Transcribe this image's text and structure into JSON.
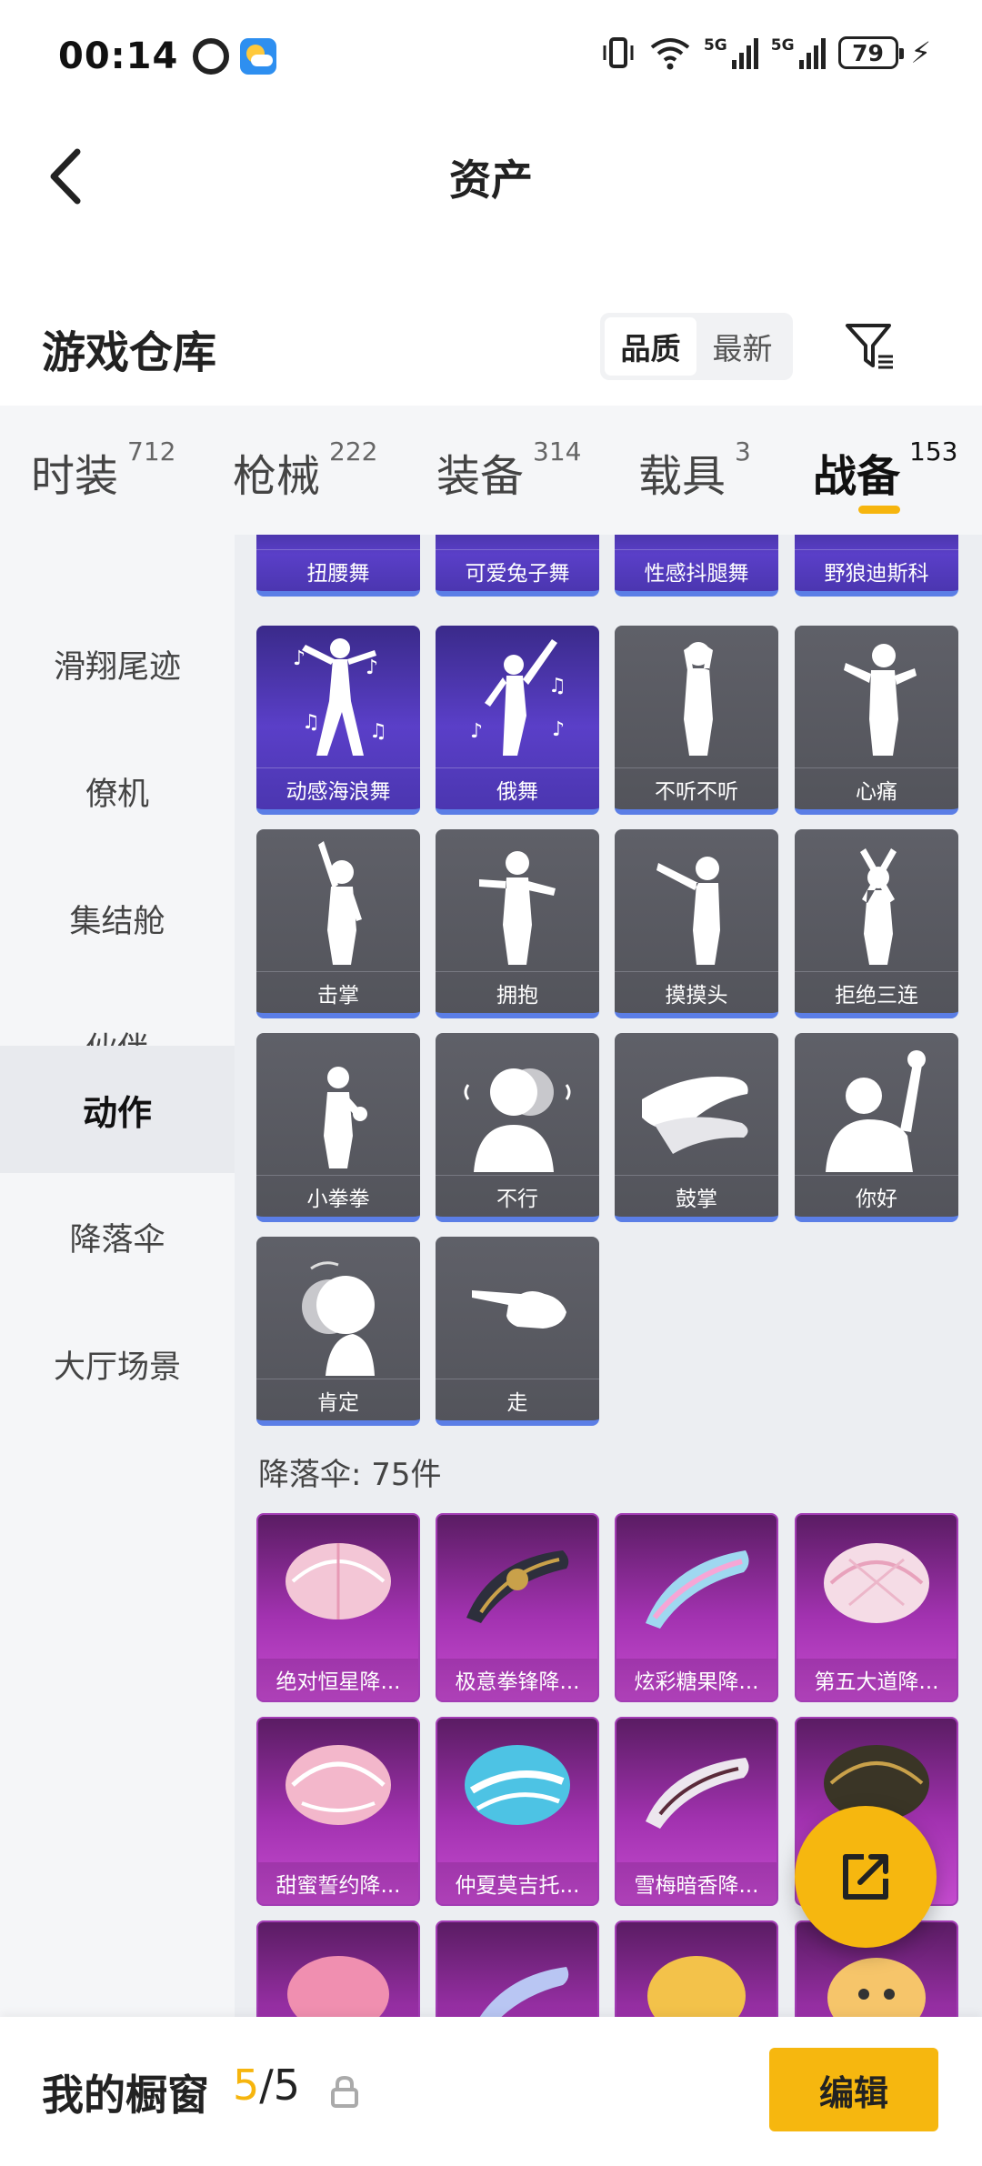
{
  "status_bar": {
    "time": "00:14",
    "battery": "79",
    "network_1": "5G",
    "network_2": "5G",
    "icons": [
      "alarm-icon",
      "weather-icon",
      "vibrate-icon",
      "wifi-icon",
      "signal-icon",
      "battery-icon",
      "charging-icon"
    ]
  },
  "nav": {
    "title": "资产",
    "back_icon": "chevron-left-icon"
  },
  "section": {
    "title": "游戏仓库",
    "sort_options": [
      "品质",
      "最新"
    ],
    "sort_selected": "品质",
    "filter_icon": "filter-icon"
  },
  "tabs": [
    {
      "label": "时装",
      "count": "712"
    },
    {
      "label": "枪械",
      "count": "222"
    },
    {
      "label": "装备",
      "count": "314"
    },
    {
      "label": "载具",
      "count": "3"
    },
    {
      "label": "战备",
      "count": "153",
      "active": true
    }
  ],
  "side_menu": [
    "滑翔尾迹",
    "僚机",
    "集结舱",
    "伙伴",
    "动作",
    "降落伞",
    "大厅场景"
  ],
  "side_menu_selected": "动作",
  "actions_partial": [
    "扭腰舞",
    "可爱兔子舞",
    "性感抖腿舞",
    "野狼迪斯科"
  ],
  "actions": [
    "动感海浪舞",
    "俄舞",
    "不听不听",
    "心痛",
    "击掌",
    "拥抱",
    "摸摸头",
    "拒绝三连",
    "小拳拳",
    "不行",
    "鼓掌",
    "你好",
    "肯定",
    "走"
  ],
  "parachute_group_title": "降落伞: 75件",
  "parachutes": [
    "绝对恒星降...",
    "极意拳锋降...",
    "炫彩糖果降...",
    "第五大道降...",
    "甜蜜誓约降...",
    "仲夏莫吉托...",
    "雪梅暗香降..."
  ],
  "fab_icon": "share-icon",
  "bottom_bar": {
    "label": "我的橱窗",
    "count_current": "5",
    "count_sep": "/",
    "count_total": "5",
    "lock_icon": "lock-icon",
    "edit_label": "编辑"
  },
  "colors": {
    "accent": "#f6b70f",
    "selected_border": "#5b7ee6",
    "legendary": "#5a3fc8",
    "parachute": "#a232b0"
  }
}
